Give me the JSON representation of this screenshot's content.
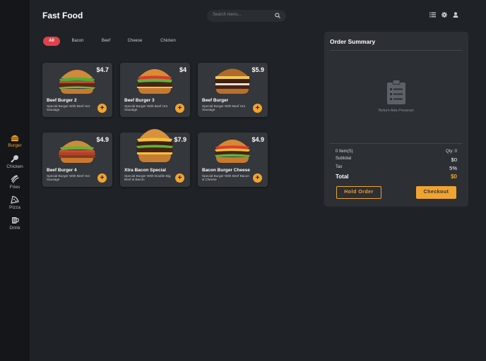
{
  "app": {
    "title": "Fast Food"
  },
  "search": {
    "placeholder": "Search menu..."
  },
  "nav": [
    {
      "label": "Burger",
      "icon": "burger-icon",
      "active": true
    },
    {
      "label": "Chicken",
      "icon": "chicken-leg-icon",
      "active": false
    },
    {
      "label": "Fries",
      "icon": "fries-icon",
      "active": false
    },
    {
      "label": "Pizza",
      "icon": "pizza-icon",
      "active": false
    },
    {
      "label": "Drink",
      "icon": "drink-icon",
      "active": false
    }
  ],
  "categories": [
    "All",
    "Bacon",
    "Beef",
    "Cheese",
    "Chicken"
  ],
  "products": [
    {
      "name": "Beef Burger 2",
      "price": "$4.7",
      "desc": "Special Burger With Beef Hot Sausage"
    },
    {
      "name": "Beef Burger 3",
      "price": "$4",
      "desc": "Special Burger With Beef Hot Sausage"
    },
    {
      "name": "Beef Burger",
      "price": "$5.9",
      "desc": "Special Burger With Beef Hot Sausage"
    },
    {
      "name": "Beef Burger 4",
      "price": "$4.9",
      "desc": "Special Burger With Beef Hot Sausage"
    },
    {
      "name": "Xtra Bacon Special",
      "price": "$7.9",
      "desc": "Special Burger With Double Big Beef & Bacon"
    },
    {
      "name": "Bacon Burger Cheese",
      "price": "$4.9",
      "desc": "Special Burger With Beef Bacon & Cheese"
    }
  ],
  "add_label": "+",
  "summary": {
    "title": "Order Summary",
    "empty_text": "Belum Ada Pesanan",
    "items_label": "0 Item(S)",
    "qty_label": "Qty: 0",
    "subtotal_label": "Subtotal",
    "subtotal_value": "$0",
    "tax_label": "Tax",
    "tax_value": "5%",
    "total_label": "Total",
    "total_value": "$0",
    "hold_label": "Hold Order",
    "checkout_label": "Checkout"
  },
  "colors": {
    "accent": "#f0a430",
    "active_chip": "#e0424b",
    "panel": "#2c2f33",
    "background": "#1f2226"
  }
}
